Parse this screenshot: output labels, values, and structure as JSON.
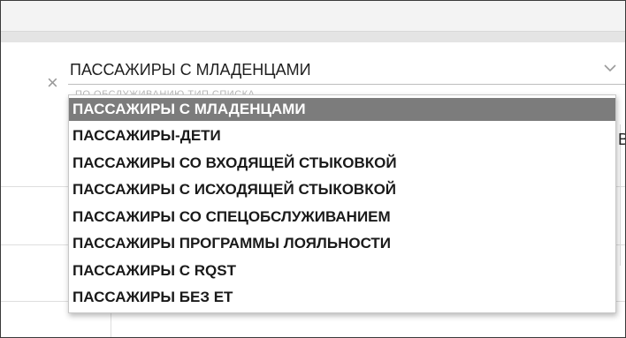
{
  "select": {
    "value": "ПАССАЖИРЫ С МЛАДЕНЦАМИ",
    "hint": "ПО ОБСЛУЖИВАНИЮ ТИП СПИСКА"
  },
  "table": {
    "clipped_header": "В"
  },
  "dropdown": {
    "options": [
      {
        "label": "ПАССАЖИРЫ С МЛАДЕНЦАМИ",
        "selected": true
      },
      {
        "label": "ПАССАЖИРЫ-ДЕТИ",
        "selected": false
      },
      {
        "label": "ПАССАЖИРЫ СО ВХОДЯЩЕЙ СТЫКОВКОЙ",
        "selected": false
      },
      {
        "label": "ПАССАЖИРЫ С ИСХОДЯЩЕЙ СТЫКОВКОЙ",
        "selected": false
      },
      {
        "label": "ПАССАЖИРЫ СО СПЕЦОБСЛУЖИВАНИЕМ",
        "selected": false
      },
      {
        "label": "ПАССАЖИРЫ ПРОГРАММЫ ЛОЯЛЬНОСТИ",
        "selected": false
      },
      {
        "label": "ПАССАЖИРЫ С RQST",
        "selected": false
      },
      {
        "label": "ПАССАЖИРЫ БЕЗ ЕТ",
        "selected": false
      }
    ]
  },
  "icons": {
    "close": "close-icon",
    "chevron": "chevron-down-icon"
  },
  "colors": {
    "selected_bg": "#7c7c7c",
    "selected_text": "#ffffff",
    "text": "#1a1a1a"
  }
}
